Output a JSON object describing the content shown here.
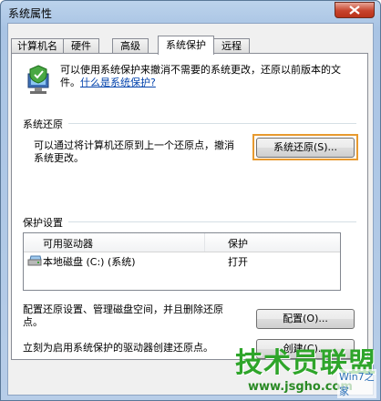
{
  "window": {
    "title": "系统属性"
  },
  "tabs": [
    {
      "label": "计算机名"
    },
    {
      "label": "硬件"
    },
    {
      "label": "高级"
    },
    {
      "label": "系统保护"
    },
    {
      "label": "远程"
    }
  ],
  "intro": {
    "text": "可以使用系统保护来撤消不需要的系统更改，还原以前版本的文件。",
    "link": "什么是系统保护?"
  },
  "restore": {
    "group_title": "系统还原",
    "description": "可以通过将计算机还原到上一个还原点，撤消系统更改。",
    "button": "系统还原(S)..."
  },
  "protection": {
    "group_title": "保护设置",
    "columns": [
      "可用驱动器",
      "保护"
    ],
    "rows": [
      {
        "drive": "本地磁盘 (C:) (系统)",
        "status": "打开"
      }
    ],
    "configure_text": "配置还原设置、管理磁盘空间，并且删除还原点。",
    "configure_button": "配置(O)...",
    "create_text": "立刻为启用系统保护的驱动器创建还原点。",
    "create_button": "创建(C)..."
  },
  "watermark": {
    "big": "技术员联盟",
    "brand": "Win7之家",
    "url": "www.jsgho.com"
  },
  "colors": {
    "highlight": "#e79a2f",
    "link": "#0645ad",
    "close": "#c7432c"
  }
}
